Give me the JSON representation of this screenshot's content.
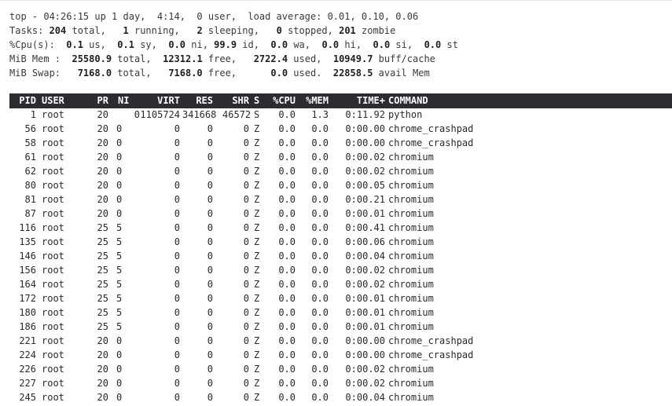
{
  "summary": {
    "line1": "top - 04:26:15 up 1 day,  4:14,  0 user,  load average: 0.01, 0.10, 0.06",
    "tasks": {
      "label": "Tasks: ",
      "total": "204",
      "total_label": " total,   ",
      "running": "1",
      "running_label": " running,   ",
      "sleeping": "2",
      "sleeping_label": " sleeping,   ",
      "stopped": "0",
      "stopped_label": " stopped, ",
      "zombie": "201",
      "zombie_label": " zombie"
    },
    "cpu": {
      "label": "%Cpu(s):  ",
      "us": "0.1",
      "us_label": " us,  ",
      "sy": "0.1",
      "sy_label": " sy,  ",
      "ni": "0.0",
      "ni_label": " ni, ",
      "id": "99.9",
      "id_label": " id,  ",
      "wa": "0.0",
      "wa_label": " wa,  ",
      "hi": "0.0",
      "hi_label": " hi,  ",
      "si": "0.0",
      "si_label": " si,  ",
      "st": "0.0",
      "st_label": " st"
    },
    "mem": {
      "label": "MiB Mem :  ",
      "total": "25580.9",
      "total_label": " total,  ",
      "free": "12312.1",
      "free_label": " free,   ",
      "used": "2722.4",
      "used_label": " used,  ",
      "buff": "10949.7",
      "buff_label": " buff/cache"
    },
    "swap": {
      "label": "MiB Swap:   ",
      "total": "7168.0",
      "total_label": " total,   ",
      "free": "7168.0",
      "free_label": " free,      ",
      "used": "0.0",
      "used_label": " used.  ",
      "avail": "22858.5",
      "avail_label": " avail Mem"
    }
  },
  "columns": [
    "PID",
    "USER",
    "PR",
    "NI",
    "VIRT",
    "RES",
    "SHR",
    "S",
    "%CPU",
    "%MEM",
    "TIME+",
    "COMMAND"
  ],
  "processes": [
    {
      "pid": "1",
      "user": "root",
      "pr": "20",
      "ni": "0",
      "virt": "1105724",
      "res": "341668",
      "shr": "46572",
      "s": "S",
      "cpu": "0.0",
      "mem": "1.3",
      "time": "0:11.92",
      "command": "python"
    },
    {
      "pid": "56",
      "user": "root",
      "pr": "20",
      "ni": "0",
      "virt": "0",
      "res": "0",
      "shr": "0",
      "s": "Z",
      "cpu": "0.0",
      "mem": "0.0",
      "time": "0:00.00",
      "command": "chrome_crashpad"
    },
    {
      "pid": "58",
      "user": "root",
      "pr": "20",
      "ni": "0",
      "virt": "0",
      "res": "0",
      "shr": "0",
      "s": "Z",
      "cpu": "0.0",
      "mem": "0.0",
      "time": "0:00.00",
      "command": "chrome_crashpad"
    },
    {
      "pid": "61",
      "user": "root",
      "pr": "20",
      "ni": "0",
      "virt": "0",
      "res": "0",
      "shr": "0",
      "s": "Z",
      "cpu": "0.0",
      "mem": "0.0",
      "time": "0:00.02",
      "command": "chromium"
    },
    {
      "pid": "62",
      "user": "root",
      "pr": "20",
      "ni": "0",
      "virt": "0",
      "res": "0",
      "shr": "0",
      "s": "Z",
      "cpu": "0.0",
      "mem": "0.0",
      "time": "0:00.02",
      "command": "chromium"
    },
    {
      "pid": "80",
      "user": "root",
      "pr": "20",
      "ni": "0",
      "virt": "0",
      "res": "0",
      "shr": "0",
      "s": "Z",
      "cpu": "0.0",
      "mem": "0.0",
      "time": "0:00.05",
      "command": "chromium"
    },
    {
      "pid": "81",
      "user": "root",
      "pr": "20",
      "ni": "0",
      "virt": "0",
      "res": "0",
      "shr": "0",
      "s": "Z",
      "cpu": "0.0",
      "mem": "0.0",
      "time": "0:00.21",
      "command": "chromium"
    },
    {
      "pid": "87",
      "user": "root",
      "pr": "20",
      "ni": "0",
      "virt": "0",
      "res": "0",
      "shr": "0",
      "s": "Z",
      "cpu": "0.0",
      "mem": "0.0",
      "time": "0:00.01",
      "command": "chromium"
    },
    {
      "pid": "116",
      "user": "root",
      "pr": "25",
      "ni": "5",
      "virt": "0",
      "res": "0",
      "shr": "0",
      "s": "Z",
      "cpu": "0.0",
      "mem": "0.0",
      "time": "0:00.41",
      "command": "chromium"
    },
    {
      "pid": "135",
      "user": "root",
      "pr": "25",
      "ni": "5",
      "virt": "0",
      "res": "0",
      "shr": "0",
      "s": "Z",
      "cpu": "0.0",
      "mem": "0.0",
      "time": "0:00.06",
      "command": "chromium"
    },
    {
      "pid": "146",
      "user": "root",
      "pr": "25",
      "ni": "5",
      "virt": "0",
      "res": "0",
      "shr": "0",
      "s": "Z",
      "cpu": "0.0",
      "mem": "0.0",
      "time": "0:00.04",
      "command": "chromium"
    },
    {
      "pid": "156",
      "user": "root",
      "pr": "25",
      "ni": "5",
      "virt": "0",
      "res": "0",
      "shr": "0",
      "s": "Z",
      "cpu": "0.0",
      "mem": "0.0",
      "time": "0:00.02",
      "command": "chromium"
    },
    {
      "pid": "164",
      "user": "root",
      "pr": "25",
      "ni": "5",
      "virt": "0",
      "res": "0",
      "shr": "0",
      "s": "Z",
      "cpu": "0.0",
      "mem": "0.0",
      "time": "0:00.02",
      "command": "chromium"
    },
    {
      "pid": "172",
      "user": "root",
      "pr": "25",
      "ni": "5",
      "virt": "0",
      "res": "0",
      "shr": "0",
      "s": "Z",
      "cpu": "0.0",
      "mem": "0.0",
      "time": "0:00.01",
      "command": "chromium"
    },
    {
      "pid": "180",
      "user": "root",
      "pr": "25",
      "ni": "5",
      "virt": "0",
      "res": "0",
      "shr": "0",
      "s": "Z",
      "cpu": "0.0",
      "mem": "0.0",
      "time": "0:00.01",
      "command": "chromium"
    },
    {
      "pid": "186",
      "user": "root",
      "pr": "25",
      "ni": "5",
      "virt": "0",
      "res": "0",
      "shr": "0",
      "s": "Z",
      "cpu": "0.0",
      "mem": "0.0",
      "time": "0:00.01",
      "command": "chromium"
    },
    {
      "pid": "221",
      "user": "root",
      "pr": "20",
      "ni": "0",
      "virt": "0",
      "res": "0",
      "shr": "0",
      "s": "Z",
      "cpu": "0.0",
      "mem": "0.0",
      "time": "0:00.00",
      "command": "chrome_crashpad"
    },
    {
      "pid": "224",
      "user": "root",
      "pr": "20",
      "ni": "0",
      "virt": "0",
      "res": "0",
      "shr": "0",
      "s": "Z",
      "cpu": "0.0",
      "mem": "0.0",
      "time": "0:00.00",
      "command": "chrome_crashpad"
    },
    {
      "pid": "226",
      "user": "root",
      "pr": "20",
      "ni": "0",
      "virt": "0",
      "res": "0",
      "shr": "0",
      "s": "Z",
      "cpu": "0.0",
      "mem": "0.0",
      "time": "0:00.02",
      "command": "chromium"
    },
    {
      "pid": "227",
      "user": "root",
      "pr": "20",
      "ni": "0",
      "virt": "0",
      "res": "0",
      "shr": "0",
      "s": "Z",
      "cpu": "0.0",
      "mem": "0.0",
      "time": "0:00.02",
      "command": "chromium"
    },
    {
      "pid": "245",
      "user": "root",
      "pr": "20",
      "ni": "0",
      "virt": "0",
      "res": "0",
      "shr": "0",
      "s": "Z",
      "cpu": "0.0",
      "mem": "0.0",
      "time": "0:00.04",
      "command": "chromium"
    }
  ],
  "colors": {
    "header_bg": "#2b2d31",
    "header_fg": "#ffffff",
    "text": "#2a2a2a"
  }
}
